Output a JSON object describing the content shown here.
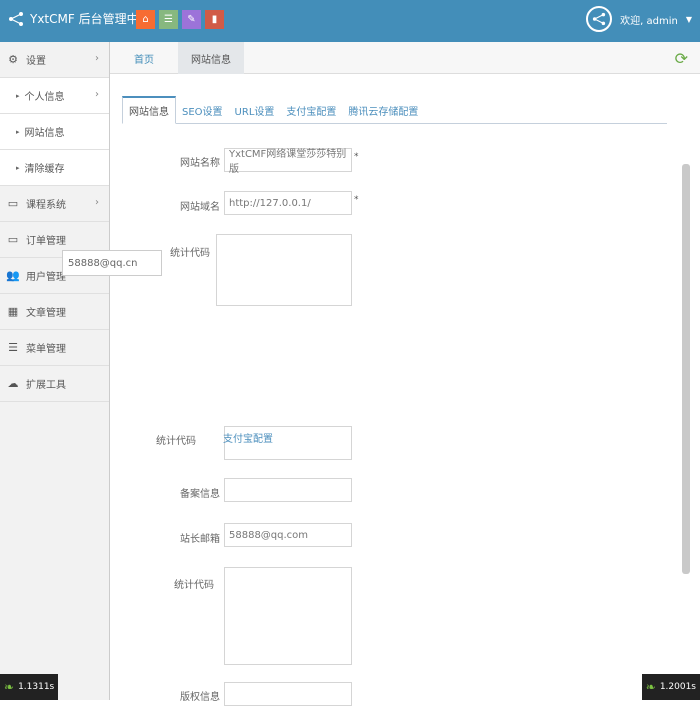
{
  "header": {
    "brand": "YxtCMF 后台管理中心",
    "greeting": "欢迎, admin",
    "colors": {
      "navbar": "#438eb9"
    }
  },
  "quick_buttons": [
    {
      "icon": "home-icon",
      "color": "#f76c32"
    },
    {
      "icon": "list-icon",
      "color": "#87b87f"
    },
    {
      "icon": "pencil-icon",
      "color": "#9c73d9"
    },
    {
      "icon": "bookmark-icon",
      "color": "#d15b47"
    }
  ],
  "sidebar": {
    "items": [
      {
        "label": "设置",
        "icon": "gears-icon",
        "arrow": "›"
      },
      {
        "label": "个人信息",
        "sub": true,
        "arrow": "›"
      },
      {
        "label": "网站信息",
        "sub": true
      },
      {
        "label": "清除缓存",
        "sub": true
      },
      {
        "label": "课程系统",
        "icon": "desktop-icon",
        "arrow": "›"
      },
      {
        "label": "订单管理",
        "icon": "desktop-icon"
      },
      {
        "label": "用户管理",
        "icon": "users-icon"
      },
      {
        "label": "文章管理",
        "icon": "grid-icon"
      },
      {
        "label": "菜单管理",
        "icon": "list-icon"
      },
      {
        "label": "扩展工具",
        "icon": "cloud-icon"
      }
    ]
  },
  "tabs": {
    "home": "首页",
    "active": "网站信息"
  },
  "inner_tabs": [
    "网站信息",
    "SEO设置",
    "URL设置",
    "支付宝配置",
    "腾讯云存储配置"
  ],
  "form": {
    "site_name_label": "网站名称",
    "site_name_value": "YxtCMF网络课堂莎莎特别版",
    "site_domain_label": "网站域名",
    "site_domain_value": "http://127.0.0.1/",
    "stats_code_label": "统计代码",
    "stats_code_label_2": "统计代码",
    "icp_label": "备案信息",
    "admin_email_label": "站长邮箱",
    "admin_email_value": "58888@qq.com",
    "stats_code_label_3": "统计代码",
    "copyright_label": "版权信息",
    "required_mark": "*"
  },
  "floating": {
    "email_value": "58888@qq.cn",
    "link_text": "支付宝配置"
  },
  "timers": {
    "left": "1.1311s",
    "right": "1.2001s"
  }
}
